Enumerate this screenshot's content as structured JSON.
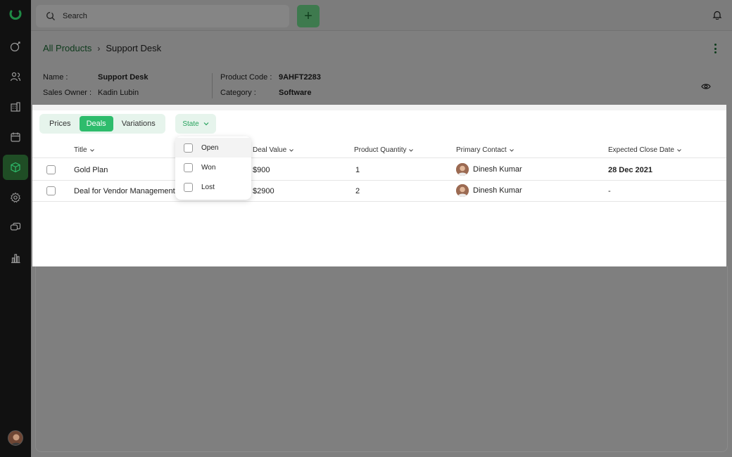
{
  "sidebar": {
    "items": [
      {
        "icon": "dollar-icon",
        "active": false
      },
      {
        "icon": "contacts-icon",
        "active": false
      },
      {
        "icon": "building-icon",
        "active": false
      },
      {
        "icon": "calendar-icon",
        "active": false
      },
      {
        "icon": "cube-icon",
        "active": true
      },
      {
        "icon": "gear-icon",
        "active": false
      },
      {
        "icon": "chat-icon",
        "active": false
      },
      {
        "icon": "chart-icon",
        "active": false
      }
    ]
  },
  "topbar": {
    "search_placeholder": "Search",
    "add_label": "+"
  },
  "breadcrumb": {
    "parent": "All Products",
    "separator": "›",
    "current": "Support Desk"
  },
  "info": {
    "name_label": "Name :",
    "name_value": "Support Desk",
    "owner_label": "Sales Owner :",
    "owner_value": "Kadin Lubin",
    "code_label": "Product Code :",
    "code_value": "9AHFT2283",
    "category_label": "Category :",
    "category_value": "Software"
  },
  "tabs": [
    {
      "label": "Prices",
      "active": false
    },
    {
      "label": "Deals",
      "active": true
    },
    {
      "label": "Variations",
      "active": false
    }
  ],
  "filter": {
    "label": "State",
    "options": [
      "Open",
      "Won",
      "Lost"
    ]
  },
  "table": {
    "columns": [
      "Title",
      "Deal Value",
      "Product Quantity",
      "Primary Contact",
      "Expected Close Date"
    ],
    "rows": [
      {
        "title": "Gold Plan",
        "value": "$900",
        "quantity": "1",
        "contact": "Dinesh Kumar",
        "close_date": "28 Dec 2021"
      },
      {
        "title": "Deal for Vendor Management",
        "value": "$2900",
        "quantity": "2",
        "contact": "Dinesh Kumar",
        "close_date": "-"
      }
    ]
  },
  "colors": {
    "accent": "#2ebc6c",
    "sidebar_bg": "#111111",
    "overlay": "#7f7f7f"
  }
}
